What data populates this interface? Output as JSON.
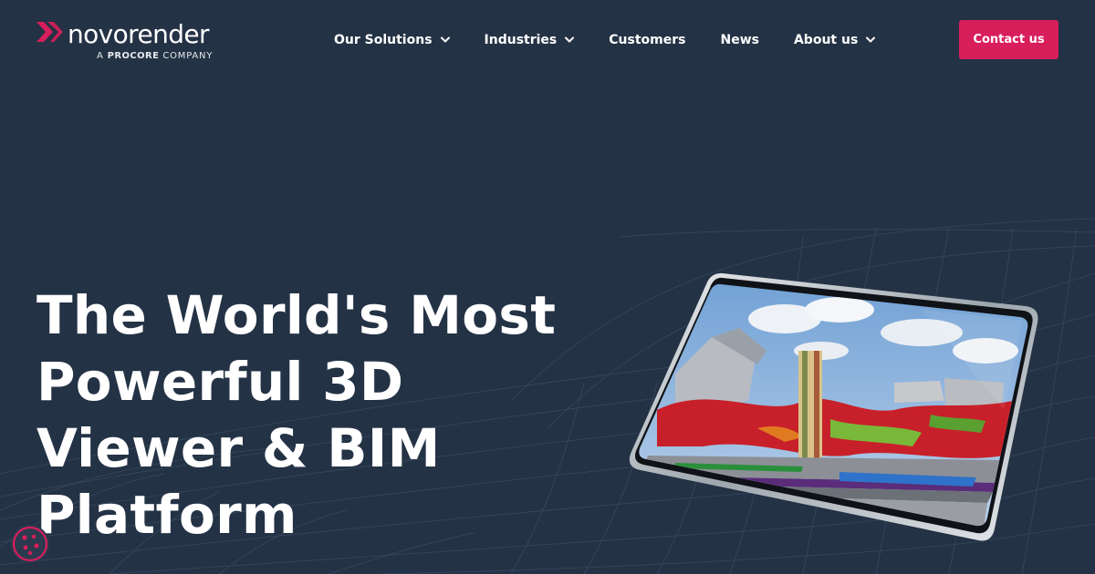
{
  "brand": {
    "name": "novorender",
    "tagline_prefix": "A",
    "tagline_brand": "PROCORE",
    "tagline_suffix": "COMPANY",
    "accent_color": "#d81e5b",
    "background_color": "#243245"
  },
  "nav": {
    "items": [
      {
        "label": "Our Solutions",
        "has_dropdown": true
      },
      {
        "label": "Industries",
        "has_dropdown": true
      },
      {
        "label": "Customers",
        "has_dropdown": false
      },
      {
        "label": "News",
        "has_dropdown": false
      },
      {
        "label": "About us",
        "has_dropdown": true
      }
    ],
    "cta_label": "Contact us"
  },
  "hero": {
    "title_lines": [
      "The World's Most",
      "Powerful 3D",
      "Viewer & BIM",
      "Platform"
    ],
    "image": "tablet-3d-bim-model"
  },
  "icons": {
    "logo": "chevron-logo-icon",
    "dropdown": "chevron-down-icon",
    "cookie": "cookie-icon"
  }
}
